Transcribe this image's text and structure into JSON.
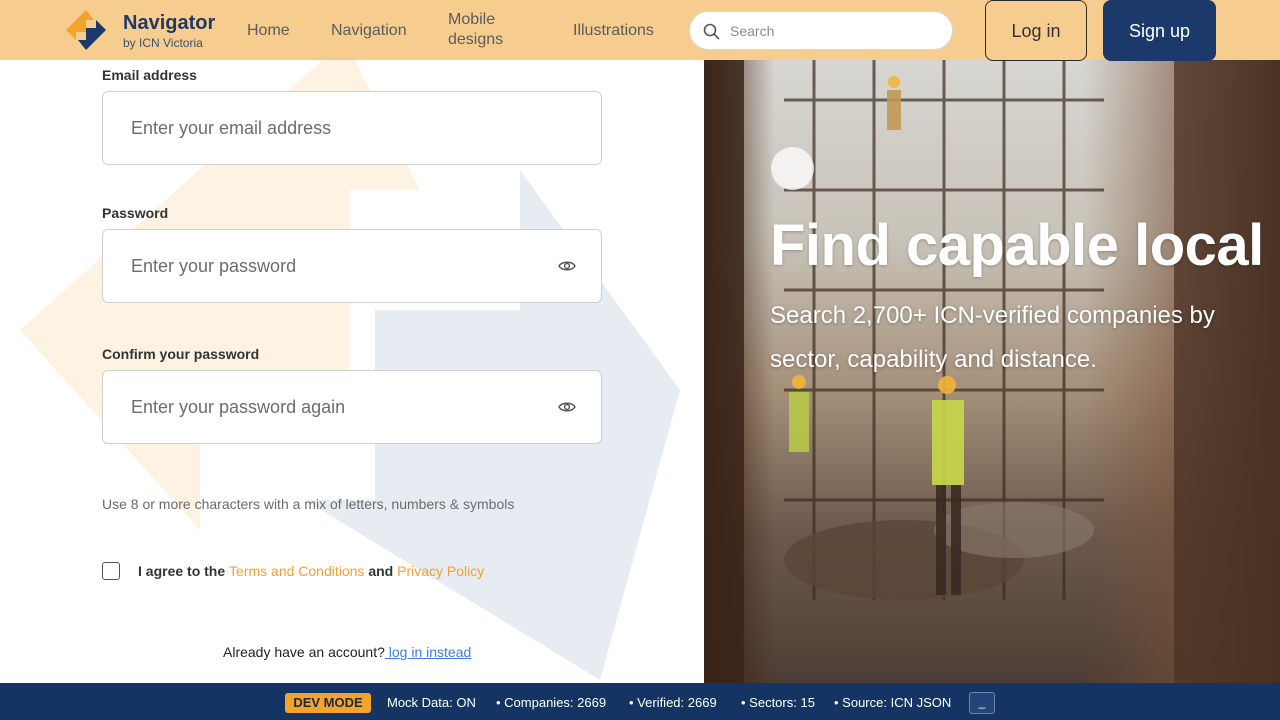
{
  "header": {
    "brand_title": "Navigator",
    "brand_subtitle": "by ICN Victoria",
    "nav": {
      "home": "Home",
      "navigation": "Navigation",
      "mobile_designs": "Mobile designs",
      "illustrations": "Illustrations"
    },
    "search_placeholder": "Search",
    "login_label": "Log in",
    "signup_label": "Sign up",
    "colors": {
      "header_bg": "#f7cd8f",
      "signup_bg": "#1b3a6b",
      "brand_text": "#1f3a63"
    }
  },
  "form": {
    "email_label": "Email address",
    "email_placeholder": "Enter your email address",
    "password_label": "Password",
    "password_placeholder": "Enter your password",
    "confirm_label": "Confirm your password",
    "confirm_placeholder": "Enter your password again",
    "password_hint": "Use 8 or more characters with a mix of letters, numbers & symbols",
    "agree_prefix": "I agree to the",
    "terms_link": "Terms and Conditions",
    "agree_and": "and",
    "privacy_link": "Privacy Policy",
    "account_prompt": "Already have an account?",
    "login_instead_link": " log in instead",
    "agree_checked": false,
    "colors": {
      "link_orange": "#f0a030",
      "link_blue": "#3f7be0"
    }
  },
  "hero": {
    "title": "Find capable local",
    "subtitle": "Search 2,700+ ICN-verified companies by sector, capability and distance."
  },
  "devbar": {
    "badge": "DEV MODE",
    "mock_data": "Mock Data: ON",
    "companies": "• Companies: 2669",
    "verified": "• Verified: 2669",
    "sectors": "• Sectors: 15",
    "source": "• Source: ICN JSON",
    "minimize": "_",
    "colors": {
      "bar_bg": "#143463",
      "badge_bg": "#f3a42c"
    }
  },
  "icons": [
    "navigator-logo-icon",
    "search-icon",
    "eye-icon",
    "eye-icon"
  ]
}
